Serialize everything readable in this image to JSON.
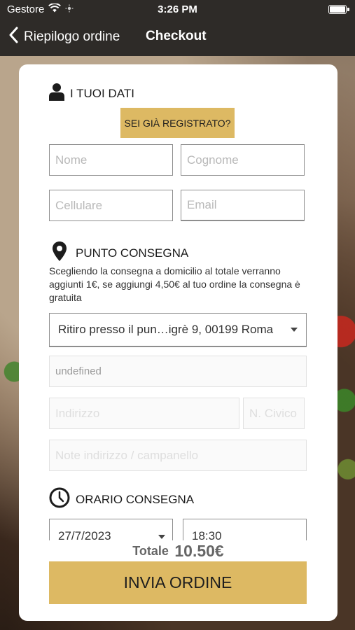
{
  "status_bar": {
    "carrier": "Gestore",
    "time": "3:26 PM"
  },
  "nav": {
    "back_label": "Riepilogo ordine",
    "title": "Checkout"
  },
  "personal": {
    "heading": "I TUOI DATI",
    "registered_button": "SEI GIÀ REGISTRATO?",
    "first_name_placeholder": "Nome",
    "last_name_placeholder": "Cognome",
    "phone_placeholder": "Cellulare",
    "email_placeholder": "Email"
  },
  "delivery": {
    "heading": "PUNTO CONSEGNA",
    "info": "Scegliendo la consegna a domicilio al totale verranno aggiunti 1€, se aggiungi 4,50€ al tuo ordine la consegna è gratuita",
    "pickup_select_value": "Ritiro presso il pun…igrè 9, 00199 Roma",
    "undefined_field_value": "undefined",
    "address_placeholder": "Indirizzo",
    "civic_placeholder": "N. Civico",
    "notes_placeholder": "Note indirizzo / campanello"
  },
  "schedule": {
    "heading": "ORARIO CONSEGNA",
    "date_value": "27/7/2023",
    "time_value": "18:30"
  },
  "summary": {
    "total_label": "Totale",
    "total_value": "10.50€",
    "submit_button": "INVIA ORDINE"
  },
  "colors": {
    "accent": "#ddb963",
    "bar": "#2e2b28"
  }
}
